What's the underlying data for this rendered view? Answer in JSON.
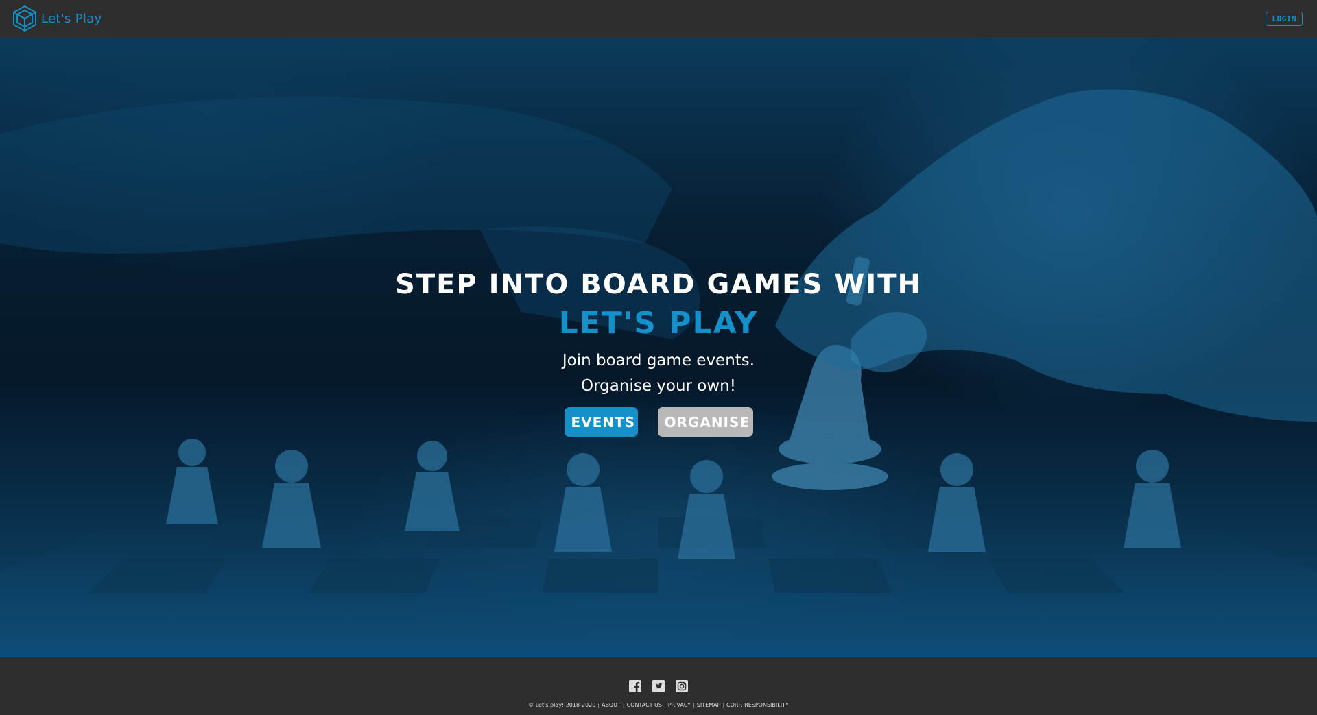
{
  "navbar": {
    "brand_name": "Let's Play",
    "login_label": "LOGIN"
  },
  "hero": {
    "title": "Step into board games with",
    "brand": "Let's Play",
    "line1": "Join board game events.",
    "line2": "Organise your own!",
    "events_label": "EVENTS",
    "organise_label": "ORGANISE"
  },
  "footer": {
    "social": [
      "facebook-icon",
      "twitter-icon",
      "instagram-icon"
    ],
    "copyright": "© Let's play! 2018-2020",
    "links": {
      "about": "ABOUT",
      "contact": "CONTACT US",
      "privacy": "PRIVACY",
      "sitemap": "SITEMAP",
      "corp": "CORP. RESPONSIBILITY"
    },
    "separator": "|"
  },
  "colors": {
    "accent": "#1590c9",
    "bar": "#2e2e2e",
    "secondary_button": "#b8b8b8"
  }
}
